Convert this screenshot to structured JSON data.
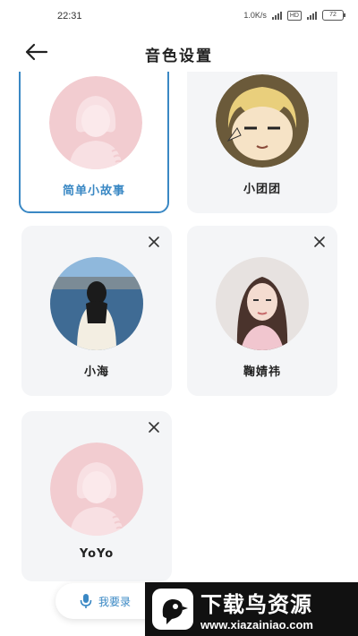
{
  "status_bar": {
    "time": "22:31",
    "network_speed": "1.0K/s",
    "hd_badge": "HD",
    "battery": "72"
  },
  "header": {
    "title": "音色设置",
    "back_icon": "arrow-left-icon"
  },
  "voices": [
    {
      "name": "简单小故事",
      "selected": true,
      "avatar": "girl-placeholder",
      "deletable": false
    },
    {
      "name": "小团团",
      "selected": false,
      "avatar": "anime-boy",
      "deletable": false
    },
    {
      "name": "小海",
      "selected": false,
      "avatar": "girl-by-sea",
      "deletable": true
    },
    {
      "name": "鞠婧祎",
      "selected": false,
      "avatar": "woman-portrait",
      "deletable": true
    },
    {
      "name": "YoYo",
      "selected": false,
      "avatar": "girl-placeholder",
      "deletable": true
    }
  ],
  "record_button": {
    "label": "我要录",
    "icon": "microphone-icon"
  },
  "watermark": {
    "title": "下载鸟资源",
    "url": "www.xiazainiao.com"
  },
  "colors": {
    "accent": "#3a88c4",
    "card_bg": "#f4f5f7",
    "placeholder_pink": "#f2ccd0"
  }
}
